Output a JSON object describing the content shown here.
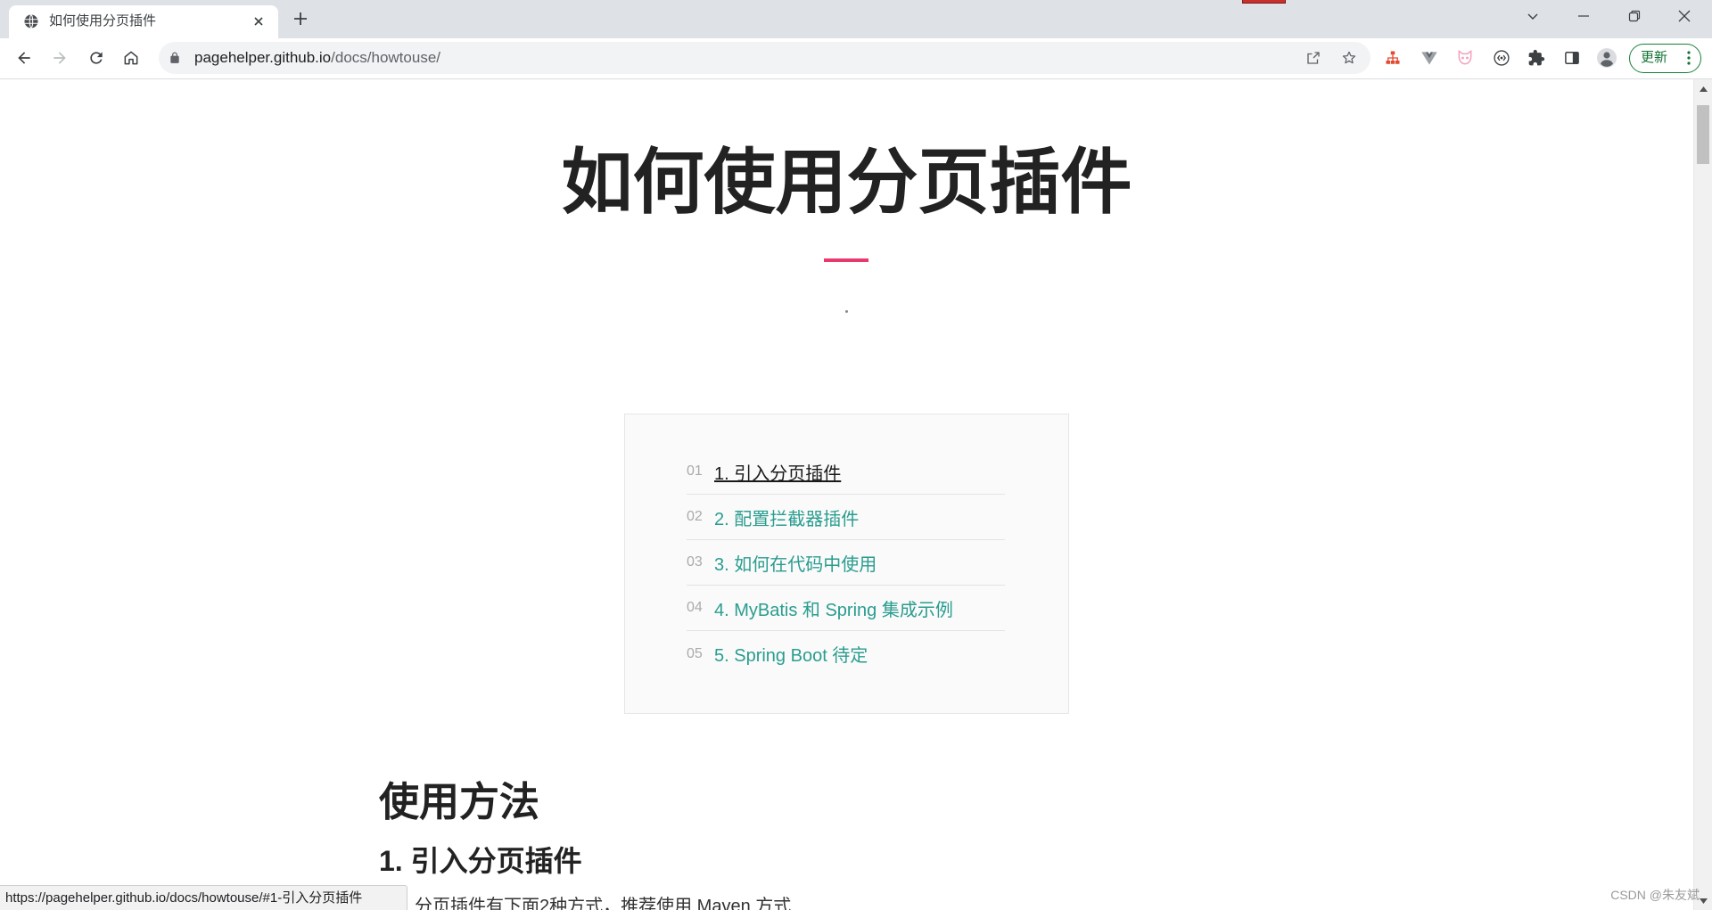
{
  "browser": {
    "tab": {
      "title": "如何使用分页插件",
      "favicon": "globe-icon",
      "close_icon": "close-icon"
    },
    "new_tab_icon": "plus-icon",
    "window_controls": [
      "chevron-down-icon",
      "minimize-icon",
      "restore-icon",
      "close-icon"
    ],
    "toolbar": {
      "nav_icons": [
        "back-arrow-icon",
        "forward-arrow-icon",
        "reload-icon",
        "home-icon"
      ],
      "forward_enabled": false
    },
    "omnibox": {
      "host": "pagehelper.github.io",
      "path": "/docs/howtouse/",
      "icons": [
        "lock-icon",
        "share-icon",
        "star-icon"
      ]
    },
    "extensions": [
      "sitemap-extension-icon",
      "v-extension-icon",
      "cat-extension-icon",
      "code-circle-extension-icon",
      "puzzle-icon",
      "side-panel-icon",
      "profile-avatar-icon"
    ],
    "update_button": {
      "label": "更新",
      "icon": "more-vert-icon"
    }
  },
  "page": {
    "title": "如何使用分页插件",
    "toc": [
      {
        "num": "01",
        "label": "1. 引入分页插件",
        "active": true
      },
      {
        "num": "02",
        "label": "2. 配置拦截器插件",
        "active": false
      },
      {
        "num": "03",
        "label": "3. 如何在代码中使用",
        "active": false
      },
      {
        "num": "04",
        "label": "4. MyBatis 和 Spring 集成示例",
        "active": false
      },
      {
        "num": "05",
        "label": "5. Spring Boot 待定",
        "active": false
      }
    ],
    "section_heading": "使用方法",
    "sub_heading": "1. 引入分页插件",
    "paragraph": "分页插件有下面2种方式，推荐使用 Maven 方式"
  },
  "status_bar": {
    "url": "https://pagehelper.github.io/docs/howtouse/#1-引入分页插件"
  },
  "watermark": "CSDN @朱友斌",
  "scrollbar": {
    "scroll_fraction": 0.01,
    "visible_fraction": 0.074
  },
  "colors": {
    "accent": "#e8386d",
    "link": "#2a9d8f",
    "update": "#188038"
  }
}
